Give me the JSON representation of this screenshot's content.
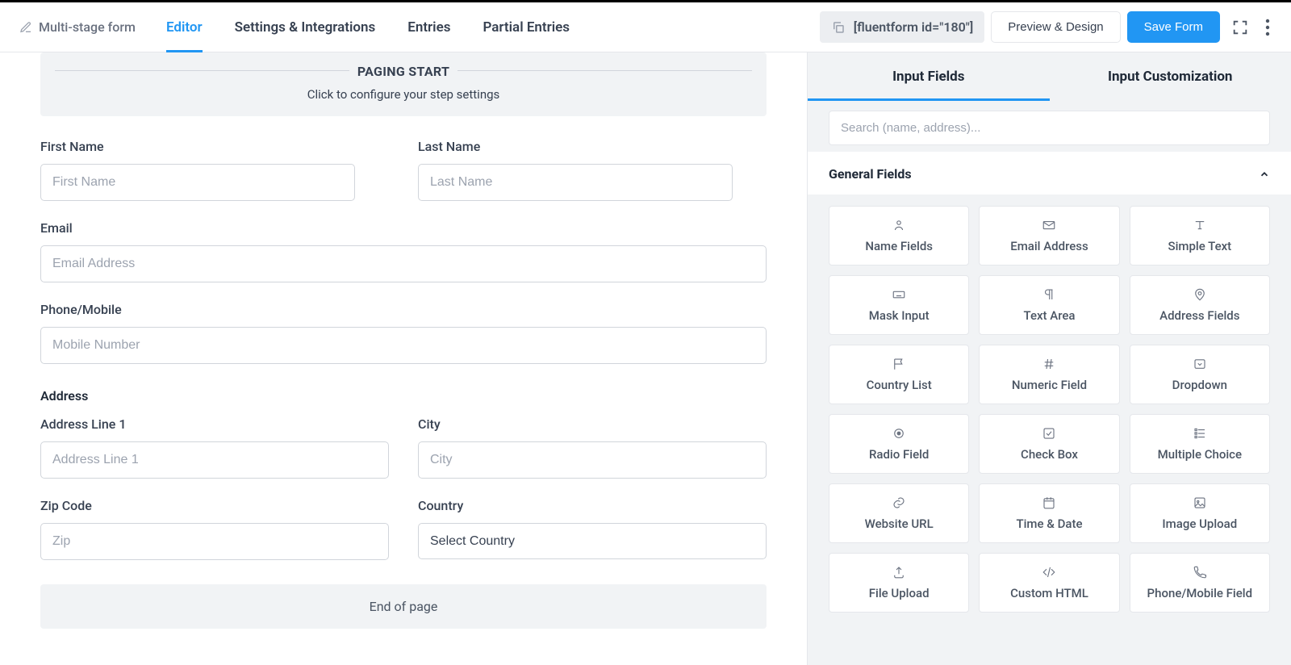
{
  "header": {
    "form_title": "Multi-stage form",
    "shortcode": "[fluentform id=\"180\"]",
    "preview_label": "Preview & Design",
    "save_label": "Save Form",
    "tabs": [
      {
        "label": "Editor",
        "active": true
      },
      {
        "label": "Settings & Integrations",
        "active": false
      },
      {
        "label": "Entries",
        "active": false
      },
      {
        "label": "Partial Entries",
        "active": false
      }
    ]
  },
  "paging": {
    "title": "PAGING START",
    "subtitle": "Click to configure your step settings",
    "end_label": "End of page"
  },
  "form": {
    "first_name_label": "First Name",
    "first_name_placeholder": "First Name",
    "last_name_label": "Last Name",
    "last_name_placeholder": "Last Name",
    "email_label": "Email",
    "email_placeholder": "Email Address",
    "phone_label": "Phone/Mobile",
    "phone_placeholder": "Mobile Number",
    "address_section": "Address",
    "addr1_label": "Address Line 1",
    "addr1_placeholder": "Address Line 1",
    "city_label": "City",
    "city_placeholder": "City",
    "zip_label": "Zip Code",
    "zip_placeholder": "Zip",
    "country_label": "Country",
    "country_value": "Select Country"
  },
  "sidebar": {
    "tabs": {
      "input": "Input Fields",
      "customize": "Input Customization"
    },
    "search_placeholder": "Search (name, address)...",
    "section_title": "General Fields",
    "fields": [
      {
        "icon": "user-icon",
        "label": "Name Fields"
      },
      {
        "icon": "envelope-icon",
        "label": "Email Address"
      },
      {
        "icon": "text-t-icon",
        "label": "Simple Text"
      },
      {
        "icon": "keyboard-icon",
        "label": "Mask Input"
      },
      {
        "icon": "pilcrow-icon",
        "label": "Text Area"
      },
      {
        "icon": "pin-icon",
        "label": "Address Fields"
      },
      {
        "icon": "flag-icon",
        "label": "Country List"
      },
      {
        "icon": "hash-icon",
        "label": "Numeric Field"
      },
      {
        "icon": "dropdown-icon",
        "label": "Dropdown"
      },
      {
        "icon": "radio-icon",
        "label": "Radio Field"
      },
      {
        "icon": "check-icon",
        "label": "Check Box"
      },
      {
        "icon": "list-icon",
        "label": "Multiple Choice"
      },
      {
        "icon": "link-icon",
        "label": "Website URL"
      },
      {
        "icon": "calendar-icon",
        "label": "Time & Date"
      },
      {
        "icon": "image-icon",
        "label": "Image Upload"
      },
      {
        "icon": "upload-icon",
        "label": "File Upload"
      },
      {
        "icon": "code-icon",
        "label": "Custom HTML"
      },
      {
        "icon": "phone-icon",
        "label": "Phone/Mobile Field"
      }
    ]
  }
}
